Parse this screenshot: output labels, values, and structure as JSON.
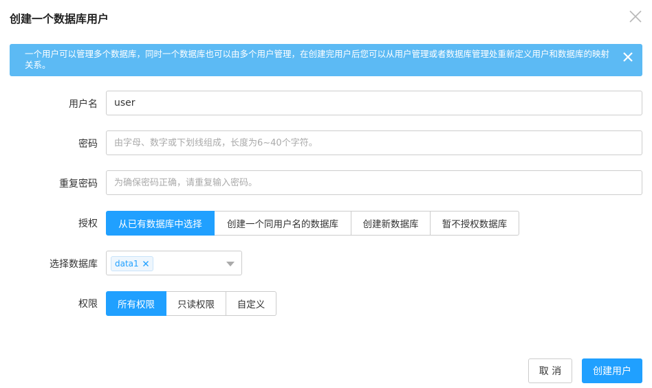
{
  "dialog": {
    "title": "创建一个数据库用户"
  },
  "alert": {
    "text": "一个用户可以管理多个数据库，同时一个数据库也可以由多个用户管理，在创建完用户后您可以从用户管理或者数据库管理处重新定义用户和数据库的映射关系。"
  },
  "form": {
    "username": {
      "label": "用户名",
      "value": "user"
    },
    "password": {
      "label": "密码",
      "placeholder": "由字母、数字或下划线组成，长度为6~40个字符。"
    },
    "confirm_password": {
      "label": "重复密码",
      "placeholder": "为确保密码正确，请重复输入密码。"
    },
    "grant": {
      "label": "授权",
      "options": [
        "从已有数据库中选择",
        "创建一个同用户名的数据库",
        "创建新数据库",
        "暂不授权数据库"
      ],
      "selected_index": 0
    },
    "database": {
      "label": "选择数据库",
      "tags": [
        "data1"
      ]
    },
    "permission": {
      "label": "权限",
      "options": [
        "所有权限",
        "只读权限",
        "自定义"
      ],
      "selected_index": 0
    }
  },
  "footer": {
    "cancel_label": "取 消",
    "submit_label": "创建用户"
  },
  "colors": {
    "primary": "#20a0ff",
    "alert_bg": "#5cbaf4",
    "border": "#cccccc"
  }
}
